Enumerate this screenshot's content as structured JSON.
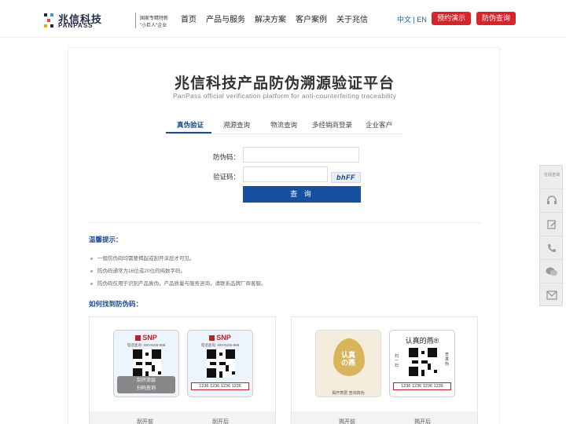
{
  "header": {
    "logo_cn": "兆信科技",
    "logo_en": "PANPASS",
    "logo_tag1": "国家专精特新",
    "logo_tag2": "\"小巨人\"企业",
    "nav": [
      "首页",
      "产品与服务",
      "解决方案",
      "客户案例",
      "关于兆信"
    ],
    "lang": "中文 | EN",
    "demo_button": "预约演示",
    "check_button": "防伪查询"
  },
  "main": {
    "title": "兆信科技产品防伪溯源验证平台",
    "subtitle": "PanPass official verification platform for anti-counterfeiting traceability",
    "tabs": [
      "真伪验证",
      "溯源查询",
      "物流查询",
      "多经销商登录",
      "企业客户"
    ],
    "active_tab": 0,
    "form": {
      "code_label": "防伪码：",
      "code_value": "",
      "verify_label": "验证码：",
      "verify_value": "",
      "captcha_text": "bhFF",
      "submit": "查 询"
    },
    "tips_title": "温馨提示：",
    "tips": [
      "一般防伪码均需要揭起或刮开涂层才可见。",
      "防伪码通常为16位或20位的纯数字码。",
      "防伪码仅用于识别产品真伪，产品质量与服务咨询，请联系品牌厂商客服。"
    ],
    "howto_title": "如何找到防伪码：",
    "samples": {
      "left": {
        "brand": "SNP",
        "phone": "电话查询: 400-8155-888",
        "scratch_text_1": "刮开涂层",
        "scratch_text_2": "扫码查询",
        "code": "1236 1236 1236 1236",
        "caption_before": "刮开前",
        "caption_after": "刮开后"
      },
      "right": {
        "gold_text_1": "认真",
        "gold_text_2": "の燕",
        "gold_foot": "揭开表层 查询真伪",
        "bird_title": "认真的燕®",
        "side_left": "扫一扫",
        "side_right": "查真伪",
        "code": "1236 1236 1236 1236",
        "caption_before": "揭开前",
        "caption_after": "揭开后"
      }
    }
  },
  "sidebar": {
    "online_text": "在线咨询",
    "icons": [
      "headset-icon",
      "edit-icon",
      "phone-icon",
      "wechat-icon",
      "mail-icon"
    ]
  },
  "colors": {
    "brand_blue": "#1750a0",
    "accent_red": "#d6242b"
  }
}
